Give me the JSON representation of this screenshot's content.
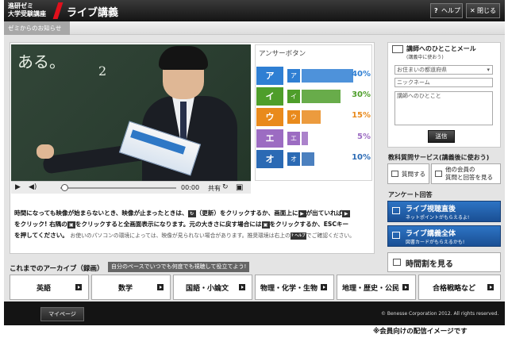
{
  "header": {
    "logo_line1": "進研ゼミ",
    "logo_line2": "大学受験講座",
    "title": "ライブ講義",
    "help_label": "ヘルプ",
    "close_label": "閉じる"
  },
  "notice": {
    "tab_label": "ゼミからのお知らせ"
  },
  "video": {
    "time": "00:00",
    "share_label": "共有",
    "chalk_text": "ある。"
  },
  "answer": {
    "title": "アンサーボタン",
    "options": [
      {
        "key": "ア",
        "percent": "40%",
        "value": 40,
        "color": "#2f7fd3"
      },
      {
        "key": "イ",
        "percent": "30%",
        "value": 30,
        "color": "#4e9e2a"
      },
      {
        "key": "ウ",
        "percent": "15%",
        "value": 15,
        "color": "#e98a1c"
      },
      {
        "key": "エ",
        "percent": "5%",
        "value": 5,
        "color": "#9c6cc2"
      },
      {
        "key": "オ",
        "percent": "10%",
        "value": 10,
        "color": "#2b6ab4"
      }
    ]
  },
  "notes": {
    "line1_a": "時間になっても映像が始まらないとき、映像が止まったときは、",
    "line1_b": "（更新）をクリックするか、画面上に",
    "line1_c": "が出ていれば",
    "line2_a": "をクリック! 右隅の",
    "line2_b": "をクリックすると全画面表示になります。元の大きさに戻す場合には",
    "line2_c": "をクリックするか、ESCキー",
    "line3_a": "を押してください。",
    "line3_b": "お使いのパソコンの環境によっては、映像が見られない場合があります。推奨環境は右上の",
    "line3_c": "でご確認ください。",
    "help_chip": "? ヘルプ"
  },
  "mail": {
    "title": "講師へのひとことメール",
    "subtitle": "(講義中に使おう)",
    "prefecture_placeholder": "お住まいの都道府県",
    "nickname_placeholder": "ニックネーム",
    "message_placeholder": "講師へのひとこと",
    "send_label": "送信"
  },
  "service": {
    "title": "教科質問サービス(講義後に使おう)",
    "question_label": "質問する",
    "others_line1": "他の会員の",
    "others_line2": "質問と回答を見る"
  },
  "survey": {
    "title": "アンケート回答",
    "btn1_main": "ライブ視聴直後",
    "btn1_sub": "ネットポイントがもらえるよ!",
    "btn2_main": "ライブ講義全体",
    "btn2_sub": "図書カードがもらえるかも!"
  },
  "timetable": {
    "label": "時間割を見る"
  },
  "archive": {
    "title": "これまでのアーカイブ（録画）",
    "subtitle": "自分のペースでいつでも何度でも視聴して役立てよう!",
    "subjects": [
      "英語",
      "数学",
      "国語・小論文",
      "物理・化学・生物",
      "地理・歴史・公民",
      "合格戦略など"
    ]
  },
  "footer": {
    "mypage_label": "マイページ",
    "copyright": "© Benesse Corporation 2012. All rights reserved.",
    "caption": "※会員向けの配信イメージです"
  }
}
